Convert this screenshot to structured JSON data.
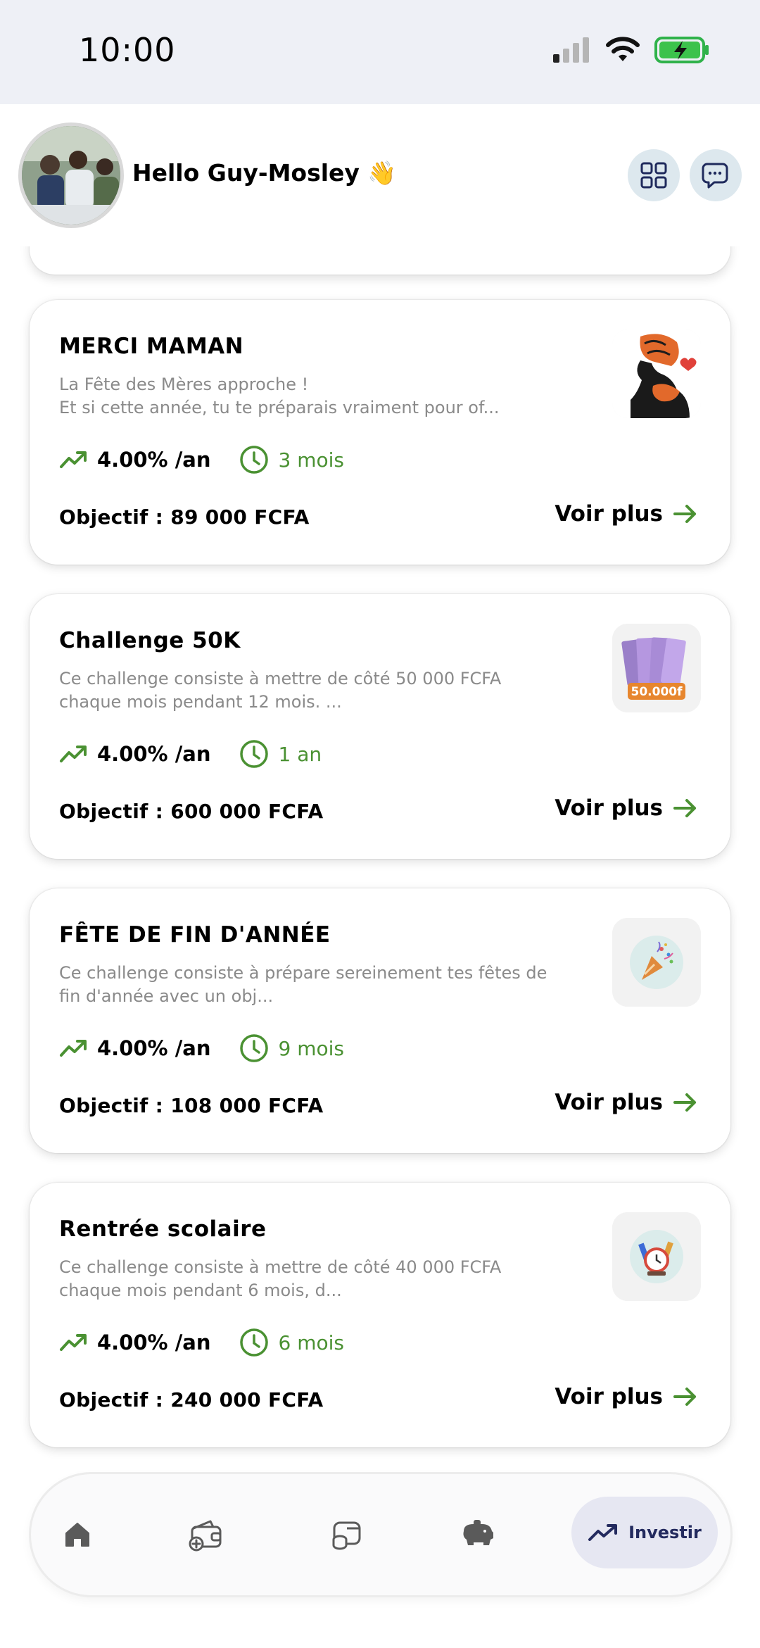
{
  "status_bar": {
    "time": "10:00"
  },
  "header": {
    "greeting": "Hello Guy-Mosley 👋"
  },
  "card_common": {
    "rate": "4.00% /an",
    "voir_plus": "Voir plus"
  },
  "cards": [
    {
      "title": "MERCI MAMAN",
      "desc_line1": "La Fête des Mères approche !",
      "desc_line2": "Et si cette année, tu te préparais vraiment pour of...",
      "duration": "3 mois",
      "objective": "Objectif : 89 000 FCFA",
      "thumb_label": ""
    },
    {
      "title": "Challenge 50K",
      "desc_line1": "Ce challenge consiste à mettre de côté 50 000 FCFA",
      "desc_line2": "chaque mois pendant 12 mois. ...",
      "duration": "1 an",
      "objective": "Objectif : 600 000 FCFA",
      "thumb_label": "50.000f"
    },
    {
      "title": "FÊTE DE FIN D'ANNÉE",
      "desc_line1": "Ce challenge consiste à prépare sereinement tes fêtes de",
      "desc_line2": "fin d'année avec un obj...",
      "duration": "9 mois",
      "objective": "Objectif : 108 000 FCFA",
      "thumb_label": ""
    },
    {
      "title": "Rentrée scolaire",
      "desc_line1": "Ce challenge consiste à mettre de côté 40 000 FCFA",
      "desc_line2": "chaque mois pendant 6 mois, d...",
      "duration": "6 mois",
      "objective": "Objectif : 240 000 FCFA",
      "thumb_label": ""
    }
  ],
  "nav": {
    "items": [
      "home-icon",
      "wallet-add-icon",
      "coins-icon",
      "piggy-bank-icon"
    ],
    "active_label": "Investir"
  },
  "colors": {
    "accent_green": "#4a9132",
    "nav_active_bg": "#e6e7f2",
    "nav_active_text": "#232a5e"
  }
}
